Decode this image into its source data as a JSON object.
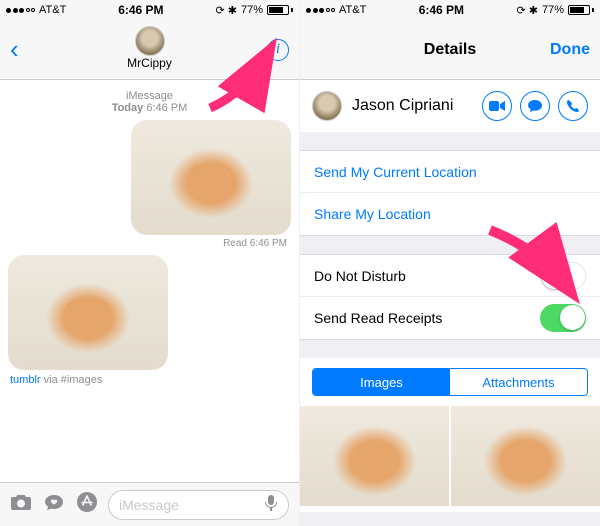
{
  "status": {
    "carrier": "AT&T",
    "time": "6:46 PM",
    "battery_pct": "77%"
  },
  "left": {
    "contact_name": "MrCippy",
    "timestamp_prefix": "iMessage",
    "timestamp_day": "Today",
    "timestamp_time": "6:46 PM",
    "read_label": "Read",
    "read_time": "6:46 PM",
    "via_link": "tumblr",
    "via_suffix": " via #images",
    "input_placeholder": "iMessage"
  },
  "right": {
    "title": "Details",
    "done": "Done",
    "contact_name": "Jason Cipriani",
    "send_location": "Send My Current Location",
    "share_location": "Share My Location",
    "dnd": "Do Not Disturb",
    "read_receipts": "Send Read Receipts",
    "dnd_on": false,
    "read_receipts_on": true,
    "seg_images": "Images",
    "seg_attachments": "Attachments"
  }
}
